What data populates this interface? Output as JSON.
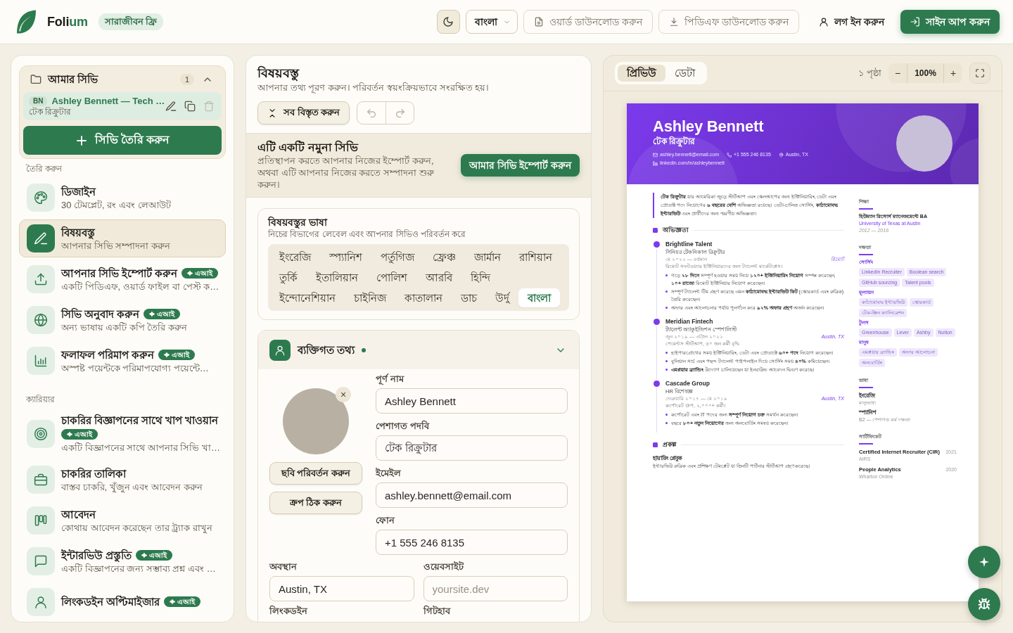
{
  "top_bar": {
    "logo_text": "Foli",
    "logo_accent": "um",
    "plan_badge": "সারাজীবন ফ্রি",
    "language_select": "বাংলা",
    "actions": [
      {
        "kind": "outline",
        "label": "ওয়ার্ড ডাউনলোড করুন"
      },
      {
        "kind": "outline",
        "label": "পিডিএফ ডাউনলোড করুন"
      },
      {
        "kind": "ghost",
        "label": "লগ ইন করুন"
      },
      {
        "kind": "primary",
        "label": "সাইন আপ করুন"
      }
    ]
  },
  "sidebar": {
    "my_cvs": {
      "title": "আমার সিভি",
      "count": "1",
      "expanded": true,
      "items": [
        {
          "initials": "BN",
          "name": "Ashley Bennett — Tech …",
          "subtitle": "টেক রিক্রুটার",
          "selected": true,
          "delete_disabled": true
        }
      ],
      "create_button": "সিভি তৈরি করুন"
    },
    "sections": [
      {
        "heading": "তৈরি করুন",
        "items": [
          {
            "title": "ডিজাইন",
            "subtitle": "30 টেমপ্লেট, রং এবং লেআউট",
            "selected": false
          },
          {
            "title": "বিষয়বস্তু",
            "subtitle": "আপনার সিভি সম্পাদনা করুন",
            "selected": true
          },
          {
            "title": "আপনার সিভি ইম্পোর্ট করুন",
            "badge": "✦ এআই",
            "subtitle": "একটি পিডিএফ, ওয়ার্ড ফাইল বা পেস্ট ক…",
            "selected": false
          },
          {
            "title": "সিভি অনুবাদ করুন",
            "badge": "✦ এআই",
            "subtitle": "অন্য ভাষায় একটি কপি তৈরি করুন",
            "selected": false
          },
          {
            "title": "ফলাফল পরিমাপ করুন",
            "badge": "✦ এআই",
            "subtitle": "অস্পষ্ট পয়েন্টকে পরিমাপযোগ্য পয়েন্টে…",
            "selected": false
          }
        ]
      },
      {
        "heading": "ক্যারিয়ার",
        "items": [
          {
            "title": "চাকরির বিজ্ঞাপনের সাথে খাপ খাওয়ান",
            "badge": "✦ এআই",
            "subtitle": "একটি বিজ্ঞাপনের সাথে আপনার সিভি খা…",
            "selected": false
          },
          {
            "title": "চাকরির তালিকা",
            "subtitle": "বাস্তব চাকরি, খুঁজুন এবং আবেদন করুন",
            "selected": false
          },
          {
            "title": "আবেদন",
            "subtitle": "কোথায় আবেদন করেছেন তার ট্র্যাক রাখুন",
            "selected": false
          },
          {
            "title": "ইন্টারভিউ প্রস্তুতি",
            "badge": "✦ এআই",
            "subtitle": "একটি বিজ্ঞাপনের জন্য সম্ভাব্য প্রশ্ন এবং …",
            "selected": false
          },
          {
            "title": "লিংকডইন অপ্টিমাইজার",
            "badge": "✦ এআই",
            "selected": false
          }
        ]
      }
    ]
  },
  "editor": {
    "title": "বিষয়বস্তু",
    "subtitle": "আপনার তথ্য পূরণ করুন। পরিবর্তন স্বয়ংক্রিয়ভাবে সংরক্ষিত হয়।",
    "expand_all": "সব বিস্তৃত করুন",
    "undo_disabled": true,
    "redo_disabled": true,
    "sample_banner": {
      "title": "এটি একটি নমুনা সিভি",
      "text": "প্রতিস্থাপন করতে আপনার নিজের ইম্পোর্ট করুন, অথবা এটি আপনার নিজের করতে সম্পাদনা শুরু করুন।",
      "button": "আমার সিভি ইম্পোর্ট করুন"
    },
    "content_language": {
      "title": "বিষয়বস্তুর ভাষা",
      "subtitle": "নিচের বিভাগের লেবেল এবং আপনার সিভিও পরিবর্তন করে",
      "options": [
        {
          "label": "ইংরেজি",
          "selected": false
        },
        {
          "label": "স্প্যানিশ",
          "selected": false
        },
        {
          "label": "পর্তুগিজ",
          "selected": false
        },
        {
          "label": "ফ্রেঞ্চ",
          "selected": false
        },
        {
          "label": "জার্মান",
          "selected": false
        },
        {
          "label": "রাশিয়ান",
          "selected": false
        },
        {
          "label": "তুর্কি",
          "selected": false
        },
        {
          "label": "ইতালিয়ান",
          "selected": false
        },
        {
          "label": "পোলিশ",
          "selected": false
        },
        {
          "label": "আরবি",
          "selected": false
        },
        {
          "label": "হিন্দি",
          "selected": false
        },
        {
          "label": "ইন্দোনেশিয়ান",
          "selected": false
        },
        {
          "label": "চাইনিজ",
          "selected": false
        },
        {
          "label": "কাতালান",
          "selected": false
        },
        {
          "label": "ডাচ",
          "selected": false
        },
        {
          "label": "উর্দু",
          "selected": false
        },
        {
          "label": "বাংলা",
          "selected": true
        }
      ]
    },
    "personal": {
      "title": "ব্যক্তিগত তথ্য",
      "complete": true,
      "expanded": true,
      "photo_remove": "×",
      "photo_buttons": [
        "ছবি পরিবর্তন করুন",
        "ক্রপ ঠিক করুন"
      ],
      "fields": [
        {
          "label": "পূর্ণ নাম",
          "value": "Ashley Bennett"
        },
        {
          "label": "পেশাগত পদবি",
          "value": "টেক রিক্রুটার"
        },
        {
          "label": "ইমেইল",
          "value": "ashley.bennett@email.com"
        },
        {
          "label": "ফোন",
          "value": "+1 555 246 8135"
        }
      ],
      "grid_fields": [
        {
          "label": "অবস্থান",
          "value": "Austin, TX"
        },
        {
          "label": "ওয়েবসাইট",
          "placeholder": "yoursite.dev"
        },
        {
          "label": "লিংকডইন"
        },
        {
          "label": "গিটহাব"
        }
      ]
    }
  },
  "preview": {
    "tabs": [
      {
        "label": "প্রিভিউ",
        "selected": true
      },
      {
        "label": "ডেটা",
        "selected": false
      }
    ],
    "page_count": "১ পৃষ্ঠা",
    "zoom_out": "−",
    "zoom_level": "100%",
    "zoom_in": "+",
    "resume": {
      "name": "Ashley Bennett",
      "title": "টেক রিক্রুটার",
      "contacts": [
        {
          "kind": "email",
          "text": "ashley.bennett@email.com"
        },
        {
          "kind": "phone",
          "text": "+1 555 246 8135"
        },
        {
          "kind": "location",
          "text": "Austin, TX"
        },
        {
          "kind": "linkedin",
          "text": "linkedin.com/in/ashleybennett"
        }
      ],
      "summary": "**টেক রিক্রুটার** যার আমেরিকা জুড়ে স্টার্টআপ এবং স্কেলআপের জন্য ইঞ্জিনিয়ারিং, ডেটা এবং প্রোডাক্ট পদে নিয়োগের **৬ বছরের বেশি** অভিজ্ঞতা রয়েছে। ডেটা-চালিত সোর্সিং, **কাঠামোবদ্ধ ইন্টারভিউ** এবং প্রার্থীদের জন্য স্মরণীয় অভিজ্ঞতা।",
      "experience": {
        "heading": "অভিজ্ঞতা",
        "jobs": [
          {
            "company": "Brightline Talent",
            "role": "সিনিয়র টেকনিকাল রিক্রুটার",
            "dates": "মে ২০২২ — বর্তমান",
            "location": "রিমোট",
            "description": "রিমোট সফটওয়্যার ইঞ্জিনিয়ারদের জন্য ট্যালেন্ট মার্কেটপ্লেস।",
            "bullets": [
              "গড়ে **২৮ দিনে** সম্পূর্ণ হওয়ার সময় নিয়ে **১২০+ ইঞ্জিনিয়ারিং নিয়োগ** সম্পন্ন করেছেন, **১০+ রাজ্যে** রিমোট ইঞ্জিনিয়ার নিয়োগ করেছেন।",
              "সম্পূর্ণ ট্যালেন্ট টিম গ্রহণ করেছে এমন **কাঠামোবদ্ধ ইন্টারভিউ কিট** (স্কোরকার্ড এবং রুব্রিক) তৈরি করেছেন।",
              "অফার এবং আলোচনার পর্যায় পুনর্গঠন করে **৯২% অফার গ্রহণ** অর্জন করেছেন।"
            ]
          },
          {
            "company": "Meridian Fintech",
            "role": "ট্যালেন্ট অ্যাকুইজিশন স্পেশালিস্ট",
            "dates": "জুন ২০১৯ — এপ্রিল ২০২২",
            "location": "Austin, TX",
            "description": "পেমেন্টস স্টার্টআপ, ৩০ জন কর্মী বৃদ্ধি",
            "bullets": [
              "হাইপারগ্রোথের সময় ইঞ্জিনিয়ারিং, ডেটা এবং প্রোডাক্টে **৬০+ পদে** নিয়োগ করেছেন।",
              "বুলিয়ান সার্চ এবং পছন্দ ট্যালেন্ট পাইপলাইন দিয়ে সোর্সিং সময় **৪০%** কমিয়েছেন।",
              "**এমপ্লয়ার ব্র্যান্ডিং** উদ্যোগ চালিয়েছেন যা ইনবাউন্ড আবেদন দ্বিগুণ করেছে।"
            ]
          },
          {
            "company": "Cascade Group",
            "role": "HR বিশেষজ্ঞ",
            "dates": "ফেব্রুয়ারি ২০১৭ — মে ২০১৯",
            "location": "Austin, TX",
            "description": "কর্পোরেট গ্রুপ, ২,০০০+ কর্মী।",
            "bullets": [
              "কর্পোরেট এবং IT পদের জন্য **সম্পূর্ণ নিয়োগ চক্র** সমর্থন করেছেন।",
              "বছরে **৮০+ নতুন নিয়োগের** জন্য অনবোর্ডিং সমন্বয় করেছেন।"
            ]
          }
        ]
      },
      "projects": {
        "heading": "প্রকল্প",
        "items": [
          {
            "name": "হায়ারিং প্লেবুক",
            "description": "ইন্টারভিউ রুব্রিক এবং প্রশিক্ষণ টেমপ্লেট যা তিনটি পার্টনার স্টার্টআপ গ্রহণ করেছে।"
          }
        ]
      },
      "education": {
        "heading": "শিক্ষা",
        "items": [
          {
            "degree": "হিউম্যান রিসোর্স ম্যানেজমেন্টে BA",
            "school": "University of Texas at Austin",
            "years": "2012 — 2016"
          }
        ]
      },
      "skills": {
        "heading": "দক্ষতা",
        "groups": [
          {
            "name": "সোর্সিং",
            "tags": [
              "LinkedIn Recruiter",
              "Boolean search",
              "GitHub sourcing",
              "Talent pools"
            ]
          },
          {
            "name": "মূল্যায়ন",
            "tags": [
              "কাঠামোবদ্ধ ইন্টারভিউ",
              "স্কোরকার্ড",
              "টেক-স্ক্রিন ক্যালিব্রেশন"
            ]
          },
          {
            "name": "টুলস",
            "tags": [
              "Greenhouse",
              "Lever",
              "Ashby",
              "Notion"
            ]
          },
          {
            "name": "মানুষ",
            "tags": [
              "এমপ্লয়ার ব্র্যান্ডিং",
              "অফার আলোচনা",
              "অনবোর্ডিং"
            ]
          }
        ]
      },
      "languages": {
        "heading": "ভাষা",
        "items": [
          {
            "name": "ইংরেজি",
            "proficiency": "মাতৃভাষা"
          },
          {
            "name": "স্প্যানিশ",
            "proficiency": "B2 — পেশাগত কর্ম দক্ষতা"
          }
        ]
      },
      "certificates": {
        "heading": "সার্টিফিকেট",
        "items": [
          {
            "name": "Certified Internet Recruiter (CIR)",
            "year": "2021",
            "issuer": "AIRS"
          },
          {
            "name": "People Analytics",
            "year": "2020",
            "issuer": "Wharton Online"
          }
        ]
      }
    }
  }
}
